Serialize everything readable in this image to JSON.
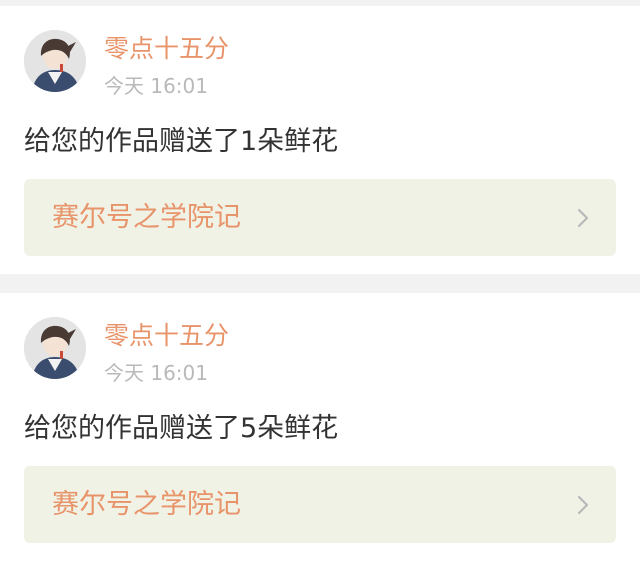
{
  "notifications": [
    {
      "user_name": "零点十五分",
      "time": "今天 16:01",
      "message": "给您的作品赠送了1朵鲜花",
      "work_title": "赛尔号之学院记",
      "avatar_icon": "avatar-icon",
      "chevron_icon": "chevron-right-icon"
    },
    {
      "user_name": "零点十五分",
      "time": "今天 16:01",
      "message": "给您的作品赠送了5朵鲜花",
      "work_title": "赛尔号之学院记",
      "avatar_icon": "avatar-icon",
      "chevron_icon": "chevron-right-icon"
    }
  ],
  "colors": {
    "accent": "#e8946a",
    "timestamp": "#b9b9b9",
    "text": "#333333",
    "link_bg": "#f1f2e6",
    "page_bg": "#f2f2f2"
  }
}
